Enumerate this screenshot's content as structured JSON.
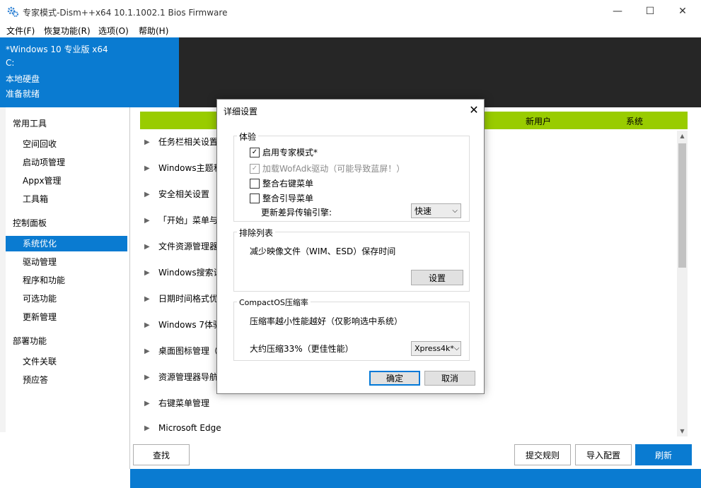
{
  "window": {
    "title": "专家模式-Dism++x64 10.1.1002.1 Bios Firmware",
    "minimize_glyph": "—",
    "maximize_glyph": "☐",
    "close_glyph": "✕"
  },
  "menu": [
    "文件(F)",
    "恢复功能(R)",
    "选项(O)",
    "帮助(H)"
  ],
  "info": {
    "os": "*Windows 10 专业版 x64",
    "drive": "C:",
    "disk_type": "本地硬盘",
    "status": "准备就绪"
  },
  "sidebar": {
    "categories": [
      {
        "label": "常用工具",
        "items": [
          "空间回收",
          "启动项管理",
          "Appx管理",
          "工具箱"
        ]
      },
      {
        "label": "控制面板",
        "items": [
          "系统优化",
          "驱动管理",
          "程序和功能",
          "可选功能",
          "更新管理"
        ]
      },
      {
        "label": "部署功能",
        "items": [
          "文件关联",
          "预应答"
        ]
      }
    ],
    "active_item": "系统优化"
  },
  "main": {
    "header_cols": [
      "新用户",
      "系统"
    ],
    "rows": [
      "任务栏相关设置",
      "Windows主题和",
      "安全相关设置",
      "「开始」菜单与",
      "文件资源管理器",
      "Windows搜索设",
      "日期时间格式优",
      "Windows 7体验",
      "桌面图标管理（",
      "资源管理器导航",
      "右键菜单管理",
      "Microsoft Edge"
    ],
    "scroll": {
      "thumb_fraction": 0.43
    }
  },
  "buttons": {
    "find": "查找",
    "submit_rules": "提交规则",
    "import_config": "导入配置",
    "refresh": "刷新"
  },
  "dialog": {
    "title": "详细设置",
    "close_glyph": "✕",
    "experience": {
      "label": "体验",
      "expert_mode": {
        "label": "启用专家模式*",
        "checked": true
      },
      "wofadk": {
        "label": "加载WofAdk驱动（可能导致蓝屏！）",
        "checked": true,
        "disabled": true
      },
      "context_menu": {
        "label": "整合右键菜单",
        "checked": false
      },
      "boot_menu": {
        "label": "整合引导菜单",
        "checked": false
      },
      "diff_engine_label": "更新差异传输引擎:",
      "diff_engine_value": "快速"
    },
    "exclusions": {
      "label": "排除列表",
      "description": "减少映像文件（WIM、ESD）保存时间",
      "settings_button": "设置"
    },
    "compact": {
      "label": "CompactOS压缩率",
      "description": "压缩率越小性能越好（仅影响选中系统）",
      "ratio_label": "大约压缩33%（更佳性能）",
      "ratio_value": "Xpress4k*"
    },
    "ok": "确定",
    "cancel": "取消"
  },
  "colors": {
    "accent": "#0a7bd1",
    "header_green": "#99cc00",
    "dark_panel": "#262626"
  }
}
